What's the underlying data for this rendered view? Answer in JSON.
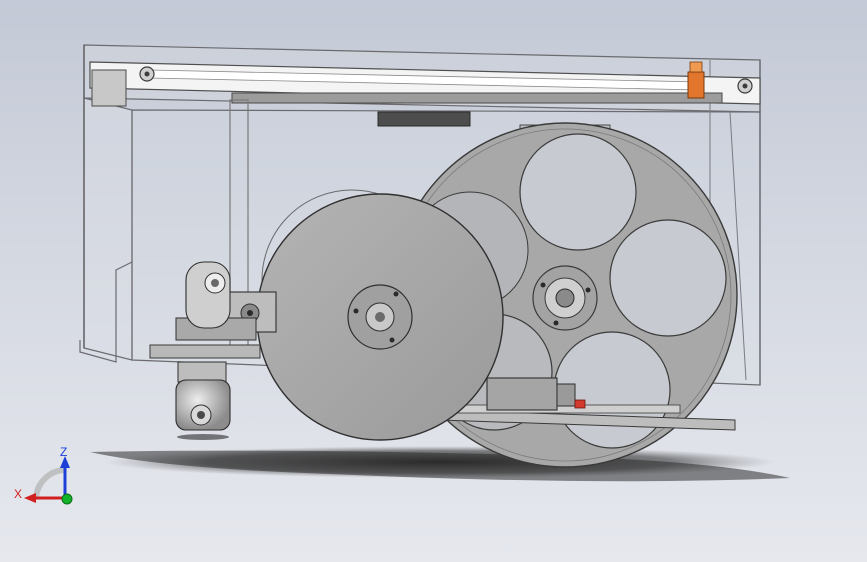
{
  "viewport": {
    "background_top": "#c3c9d6",
    "background_bottom": "#e6e8ee"
  },
  "model": {
    "parts": [
      "transparent-housing",
      "top-rail",
      "caster-wheel",
      "drive-wheel",
      "spoked-wheel",
      "gear-train",
      "motor",
      "orange-bracket"
    ]
  },
  "colors": {
    "metal": "#a9a9a9",
    "metal_dark": "#5c5c5c",
    "housing_edge": "#6b6b70",
    "accent": "#e2762c",
    "shadow": "#2a2a2a"
  },
  "triad": {
    "x_label": "X",
    "z_label": "Z",
    "x_color": "#d11f1f",
    "z_color": "#1d3fd8",
    "y_color": "#12b32a"
  }
}
